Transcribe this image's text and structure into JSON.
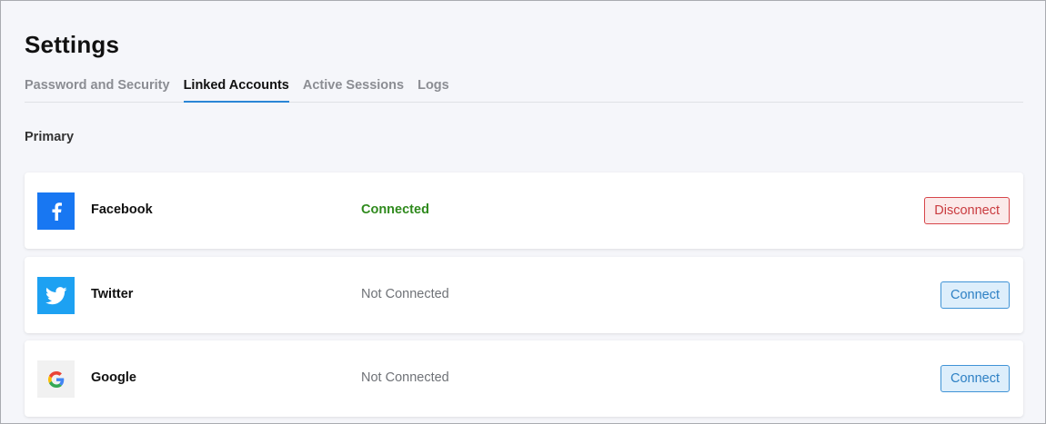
{
  "page": {
    "title": "Settings"
  },
  "tabs": [
    {
      "label": "Password and Security",
      "active": false
    },
    {
      "label": "Linked Accounts",
      "active": true
    },
    {
      "label": "Active Sessions",
      "active": false
    },
    {
      "label": "Logs",
      "active": false
    }
  ],
  "section": {
    "label": "Primary"
  },
  "accounts": [
    {
      "name": "Facebook",
      "icon": "facebook-icon",
      "status": "Connected",
      "action": "Disconnect",
      "color": "#1877f2"
    },
    {
      "name": "Twitter",
      "icon": "twitter-icon",
      "status": "Not Connected",
      "action": "Connect",
      "color": "#1da1f2"
    },
    {
      "name": "Google",
      "icon": "google-icon",
      "status": "Not Connected",
      "action": "Connect",
      "color": "#f1f1f1"
    }
  ],
  "colors": {
    "accent": "#2a86d6",
    "connected": "#2f8a1d",
    "danger": "#d7464a"
  }
}
